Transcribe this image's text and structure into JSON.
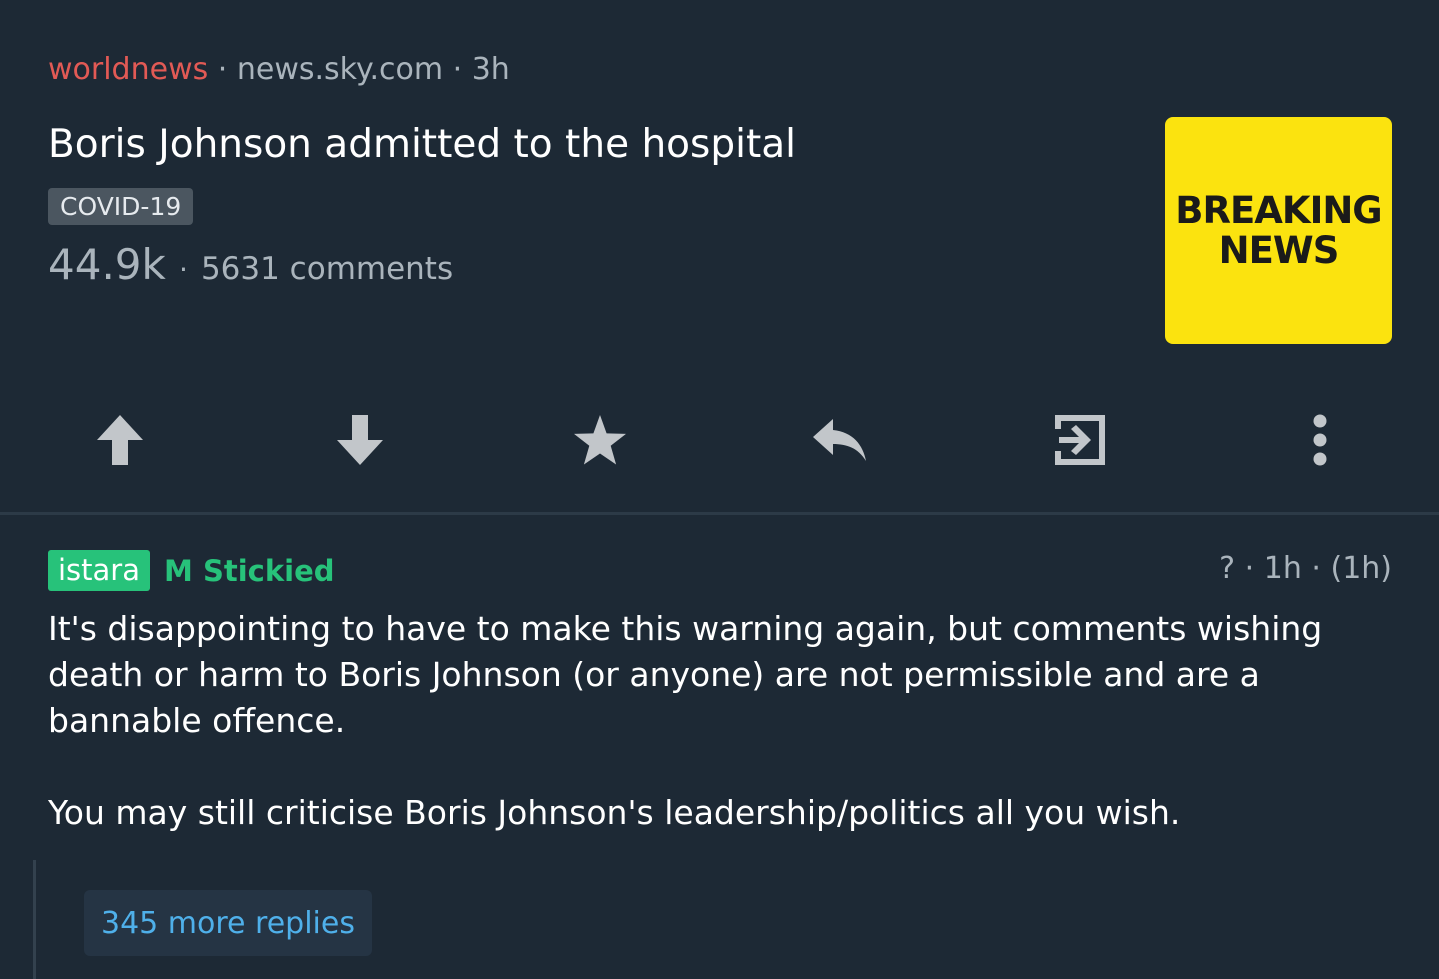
{
  "post": {
    "subreddit": "worldnews",
    "domain": "news.sky.com",
    "age": "3h",
    "title": "Boris Johnson admitted to the hospital",
    "flair": "COVID-19",
    "score": "44.9k",
    "comments": "5631 comments",
    "thumbnail": {
      "line1": "BREAKING",
      "line2": "NEWS",
      "background": "#fbe30f"
    }
  },
  "actions": [
    {
      "name": "upvote",
      "icon": "arrow-up-icon"
    },
    {
      "name": "downvote",
      "icon": "arrow-down-icon"
    },
    {
      "name": "save",
      "icon": "star-icon"
    },
    {
      "name": "reply",
      "icon": "reply-icon"
    },
    {
      "name": "open-link",
      "icon": "enter-icon"
    },
    {
      "name": "more",
      "icon": "more-vertical-icon"
    }
  ],
  "comment": {
    "author": "istara",
    "mod_badge": "M",
    "stickied_label": "Stickied",
    "score": "?",
    "age": "1h",
    "edited": "(1h)",
    "paragraphs": [
      "It's disappointing to have to make this warning again, but comments wishing death or harm to Boris Johnson (or anyone) are not permissible and are a bannable offence.",
      "You may still criticise Boris Johnson's leadership/politics all you wish."
    ],
    "more_replies": "345 more replies"
  },
  "colors": {
    "background": "#1d2935",
    "subreddit": "#e25a55",
    "moderator": "#27c27a",
    "link": "#4fb0ea",
    "icon": "#c2c6ca"
  }
}
